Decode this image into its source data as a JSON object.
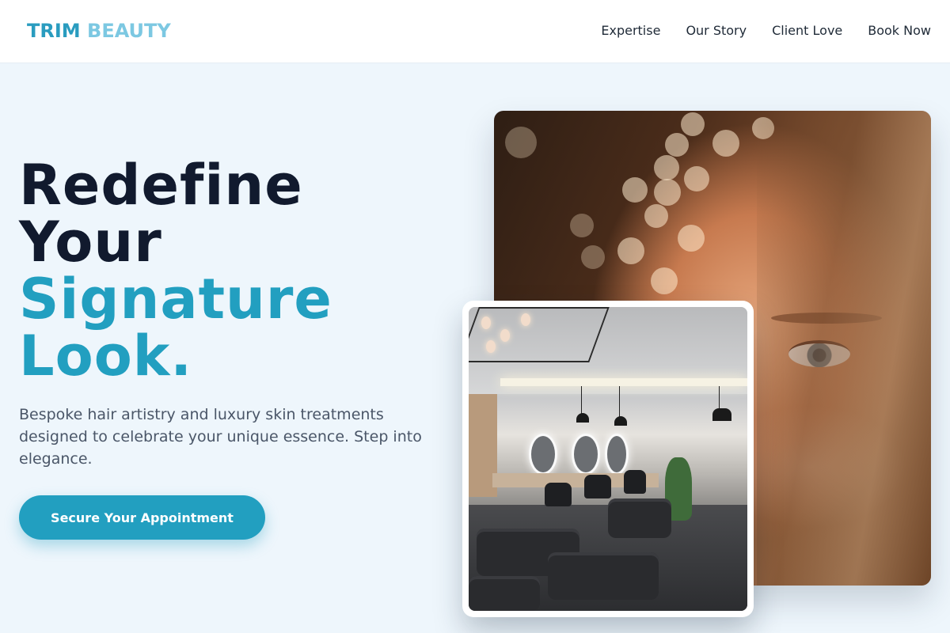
{
  "header": {
    "logo_part1": "TRIM",
    "logo_part2": "BEAUTY",
    "nav": [
      "Expertise",
      "Our Story",
      "Client Love",
      "Book Now"
    ]
  },
  "hero": {
    "headline_line1": "Redefine",
    "headline_line2": "Your",
    "headline_line3": "Signature",
    "headline_line4": "Look.",
    "subtext": "Bespoke hair artistry and luxury skin treatments designed to celebrate your unique essence. Step into elegance.",
    "cta_label": "Secure Your Appointment"
  },
  "images": {
    "portrait": "woman-portrait-closeup",
    "salon": "salon-interior"
  },
  "colors": {
    "accent": "#229fc0",
    "accent_light": "#7cc8e2",
    "heading_dark": "#111a2e",
    "background": "#eef6fc"
  }
}
